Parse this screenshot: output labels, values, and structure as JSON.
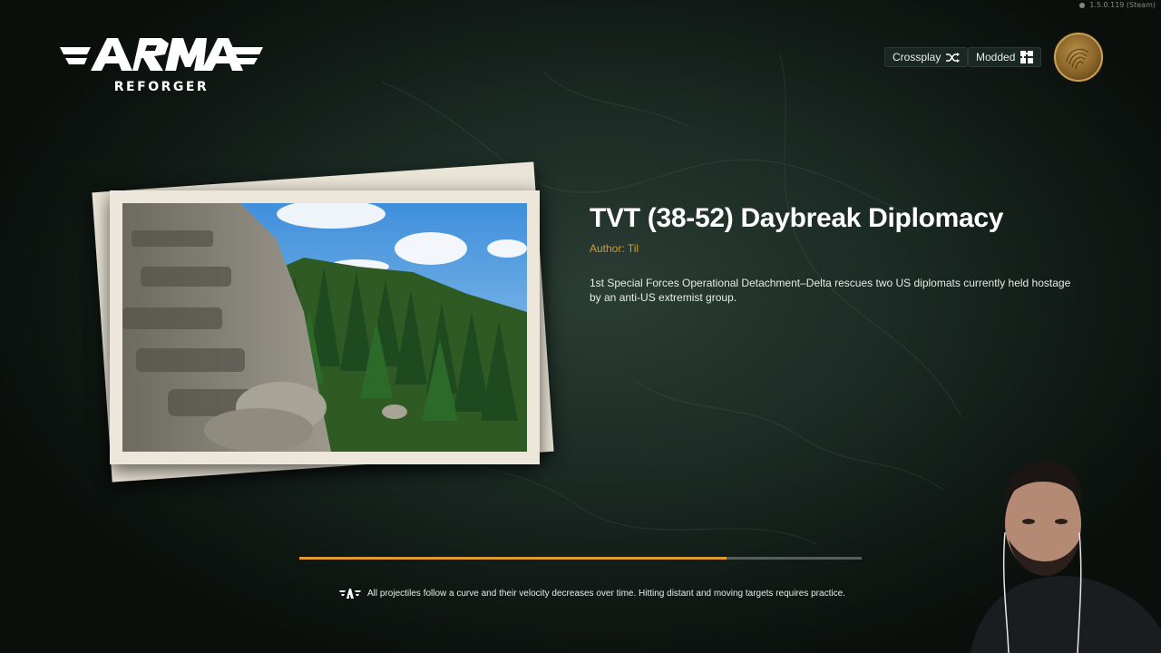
{
  "version": "1.5.0.119 (Steam)",
  "logo": {
    "title": "ARMA",
    "subtitle": "REFORGER"
  },
  "header": {
    "crossplay_label": "Crossplay",
    "crossplay_icon": "shuffle-icon",
    "modded_label": "Modded",
    "modded_icon": "puzzle-icon"
  },
  "mission": {
    "title": "TVT (38-52) Daybreak Diplomacy",
    "author": "Author: Til",
    "description": "1st Special Forces Operational Detachment–Delta rescues two US diplomats currently held hostage by an anti-US extremist group."
  },
  "loading": {
    "progress": 0.76,
    "accent": "#e09a32"
  },
  "hint": {
    "icon": "arma-wings-icon",
    "text": "All projectiles follow a curve and their velocity decreases over time. Hitting distant and moving targets requires practice."
  }
}
